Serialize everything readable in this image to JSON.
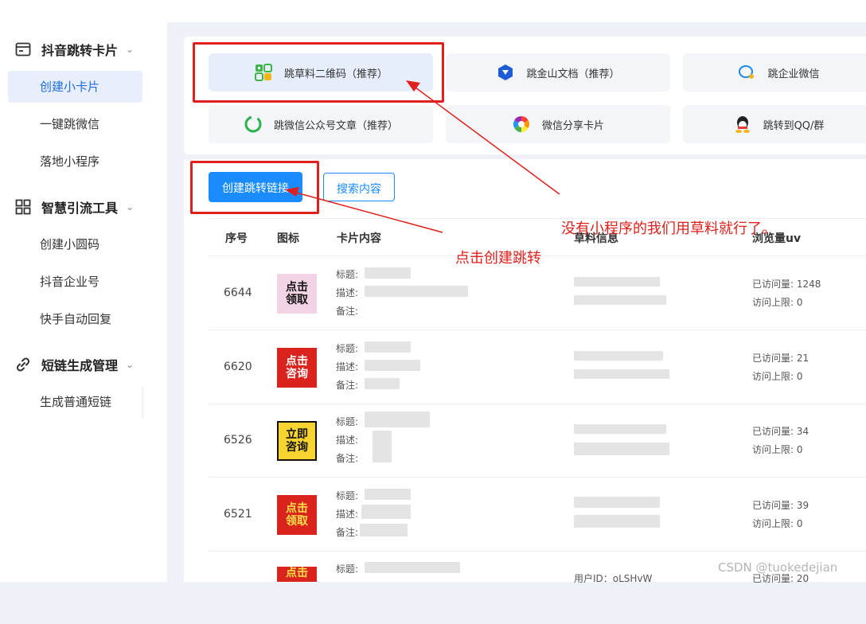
{
  "sidebar": {
    "groups": [
      {
        "title": "抖音跳转卡片",
        "icon": "card-icon",
        "items": [
          "创建小卡片",
          "一键跳微信",
          "落地小程序"
        ]
      },
      {
        "title": "智慧引流工具",
        "icon": "grid-icon",
        "items": [
          "创建小圆码",
          "抖音企业号",
          "快手自动回复"
        ]
      },
      {
        "title": "短链生成管理",
        "icon": "link-icon",
        "items": [
          "生成普通短链"
        ]
      }
    ],
    "active_item": "创建小卡片"
  },
  "jump_types": [
    {
      "label": "跳草料二维码（推荐）",
      "icon": "qrcode-icon"
    },
    {
      "label": "跳金山文档（推荐）",
      "icon": "kdocs-icon"
    },
    {
      "label": "跳企业微信",
      "icon": "wecom-icon"
    },
    {
      "label": "跳微信公众号文章（推荐）",
      "icon": "wechat-official-icon"
    },
    {
      "label": "微信分享卡片",
      "icon": "share-card-icon"
    },
    {
      "label": "跳转到QQ/群",
      "icon": "qq-icon"
    }
  ],
  "actions": {
    "create": "创建跳转链接",
    "search": "搜索内容"
  },
  "table": {
    "headers": [
      "序号",
      "图标",
      "卡片内容",
      "草料信息",
      "浏览量uv"
    ],
    "field_labels": {
      "title": "标题:",
      "desc": "描述:",
      "note": "备注:"
    },
    "visit_label": "已访问量:",
    "limit_label": "访问上限:",
    "rows": [
      {
        "id": "6644",
        "thumb": [
          "点击",
          "领取"
        ],
        "visits": "1248",
        "limit": "0"
      },
      {
        "id": "6620",
        "thumb": [
          "点击",
          "咨询"
        ],
        "visits": "21",
        "limit": "0"
      },
      {
        "id": "6526",
        "thumb": [
          "立即",
          "咨询"
        ],
        "visits": "34",
        "limit": "0"
      },
      {
        "id": "6521",
        "thumb": [
          "点击",
          "领取"
        ],
        "visits": "39",
        "limit": "0"
      },
      {
        "id": "",
        "thumb": [
          "点击",
          ""
        ],
        "visits": "20",
        "limit": ""
      }
    ],
    "partial_user_id": "用户ID：oLSHvW"
  },
  "annotations": {
    "no_miniprogram": "没有小程序的我们用草料就行了。",
    "click_create": "点击创建跳转"
  },
  "watermark": "CSDN @tuokedejian",
  "colors": {
    "primary": "#1a8cff",
    "annotation": "#e0201c",
    "active_bg": "#e8eefb"
  }
}
